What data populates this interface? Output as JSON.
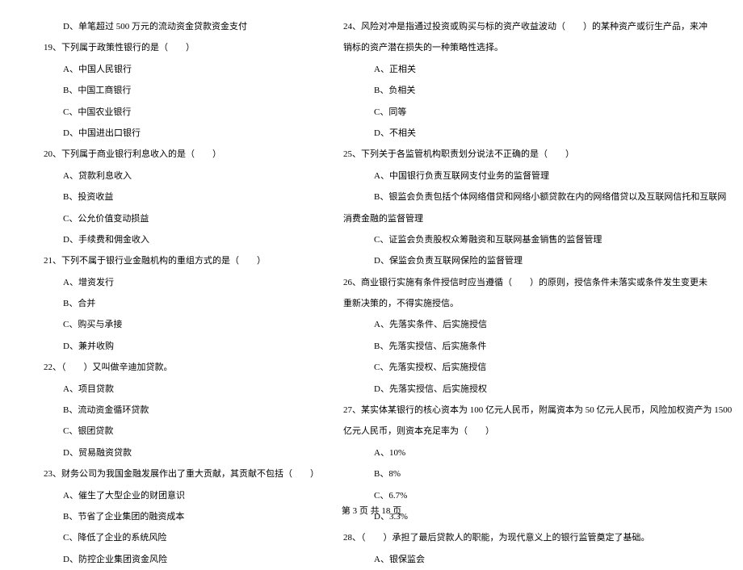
{
  "left": {
    "top_option": "D、单笔超过 500 万元的流动资金贷款资金支付",
    "q19": {
      "text": "19、下列属于政策性银行的是（　　）",
      "a": "A、中国人民银行",
      "b": "B、中国工商银行",
      "c": "C、中国农业银行",
      "d": "D、中国进出口银行"
    },
    "q20": {
      "text": "20、下列属于商业银行利息收入的是（　　）",
      "a": "A、贷款利息收入",
      "b": "B、投资收益",
      "c": "C、公允价值变动损益",
      "d": "D、手续费和佣金收入"
    },
    "q21": {
      "text": "21、下列不属于银行业金融机构的重组方式的是（　　）",
      "a": "A、增资发行",
      "b": "B、合并",
      "c": "C、购买与承接",
      "d": "D、兼并收购"
    },
    "q22": {
      "text": "22、（　　）又叫做辛迪加贷款。",
      "a": "A、项目贷款",
      "b": "B、流动资金循环贷款",
      "c": "C、银团贷款",
      "d": "D、贸易融资贷款"
    },
    "q23": {
      "text": "23、财务公司为我国金融发展作出了重大贡献，其贡献不包括（　　）",
      "a": "A、催生了大型企业的财团意识",
      "b": "B、节省了企业集团的融资成本",
      "c": "C、降低了企业的系统风险",
      "d": "D、防控企业集团资金风险"
    }
  },
  "right": {
    "q24": {
      "text1": "24、风险对冲是指通过投资或购买与标的资产收益波动（　　）的某种资产或衍生产品，来冲",
      "text2": "销标的资产潜在损失的一种策略性选择。",
      "a": "A、正相关",
      "b": "B、负相关",
      "c": "C、同等",
      "d": "D、不相关"
    },
    "q25": {
      "text": "25、下列关于各监管机构职责划分说法不正确的是（　　）",
      "a": "A、中国银行负责互联网支付业务的监督管理",
      "b1": "B、银监会负责包括个体网络借贷和网络小额贷款在内的网络借贷以及互联网信托和互联网",
      "b2": "消费金融的监督管理",
      "c": "C、证监会负责股权众筹融资和互联网基金销售的监督管理",
      "d": "D、保监会负责互联网保险的监督管理"
    },
    "q26": {
      "text1": "26、商业银行实施有条件授信时应当遵循（　　）的原则，授信条件未落实或条件发生变更未",
      "text2": "重新决策的，不得实施授信。",
      "a": "A、先落实条件、后实施授信",
      "b": "B、先落实授信、后实施条件",
      "c": "C、先落实授权、后实施授信",
      "d": "D、先落实授信、后实施授权"
    },
    "q27": {
      "text1": "27、某实体某银行的核心资本为 100 亿元人民币，附属资本为 50 亿元人民币，风险加权资产为 1500",
      "text2": "亿元人民币，则资本充足率为（　　）",
      "a": "A、10%",
      "b": "B、8%",
      "c": "C、6.7%",
      "d": "D、3.3%"
    },
    "q28": {
      "text": "28、（　　）承担了最后贷款人的职能，为现代意义上的银行监管奠定了基础。",
      "a": "A、银保监会"
    }
  },
  "footer": "第 3 页 共 18 页"
}
